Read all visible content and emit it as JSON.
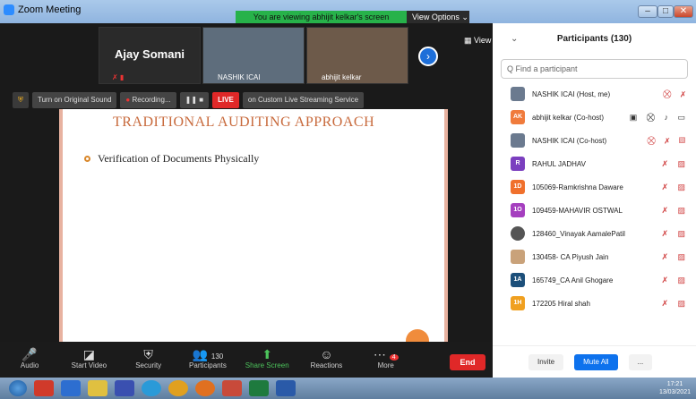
{
  "window": {
    "app_title": "Zoom Meeting",
    "viewing_banner": "You are viewing abhijit kelkar's screen",
    "view_options": "View Options ⌄"
  },
  "thumbnails": [
    {
      "name": "Ajay Somani"
    },
    {
      "name": "NASHIK ICAI"
    },
    {
      "name": "abhijit kelkar"
    }
  ],
  "view_button": "View",
  "share_toolbar": {
    "sound": "Turn on Original Sound",
    "recording": "Recording...",
    "live": "LIVE",
    "streaming": "on Custom Live Streaming Service"
  },
  "slide": {
    "title": "TRADITIONAL AUDITING APPROACH",
    "bullet": "Verification of Documents Physically"
  },
  "bottombar": {
    "audio": "Audio",
    "start_video": "Start Video",
    "security": "Security",
    "participants": "Participants",
    "participants_count": "130",
    "share_screen": "Share Screen",
    "reactions": "Reactions",
    "more": "More",
    "more_badge": "4",
    "end": "End"
  },
  "panel": {
    "title": "Participants (130)",
    "search_placeholder": "Q Find a participant",
    "participants": [
      {
        "name": "NASHIK ICAI (Host, me)",
        "avatar": "",
        "color": "#6b7a8f"
      },
      {
        "name": "abhijit kelkar (Co-host)",
        "avatar": "AK",
        "color": "#f07b3c"
      },
      {
        "name": "NASHIK ICAI (Co-host)",
        "avatar": "",
        "color": "#6b7a8f"
      },
      {
        "name": "RAHUL JADHAV",
        "avatar": "R",
        "color": "#7b3fbf"
      },
      {
        "name": "105069-Ramkrishna Daware",
        "avatar": "1D",
        "color": "#f0702c"
      },
      {
        "name": "109459-MAHAVIR OSTWAL",
        "avatar": "1O",
        "color": "#a53fbf"
      },
      {
        "name": "128460_Vinayak AamalePatil",
        "avatar": "",
        "color": "#555"
      },
      {
        "name": "130458- CA Piyush Jain",
        "avatar": "",
        "color": "#c9a27a"
      },
      {
        "name": "165749_CA Anil Ghogare",
        "avatar": "1A",
        "color": "#1c4f7a"
      },
      {
        "name": "172205 Hiral shah",
        "avatar": "1H",
        "color": "#f0a020"
      }
    ],
    "invite": "Invite",
    "mute_all": "Mute All",
    "more": "..."
  },
  "taskbar": {
    "time": "17:21",
    "date": "13/03/2021"
  }
}
